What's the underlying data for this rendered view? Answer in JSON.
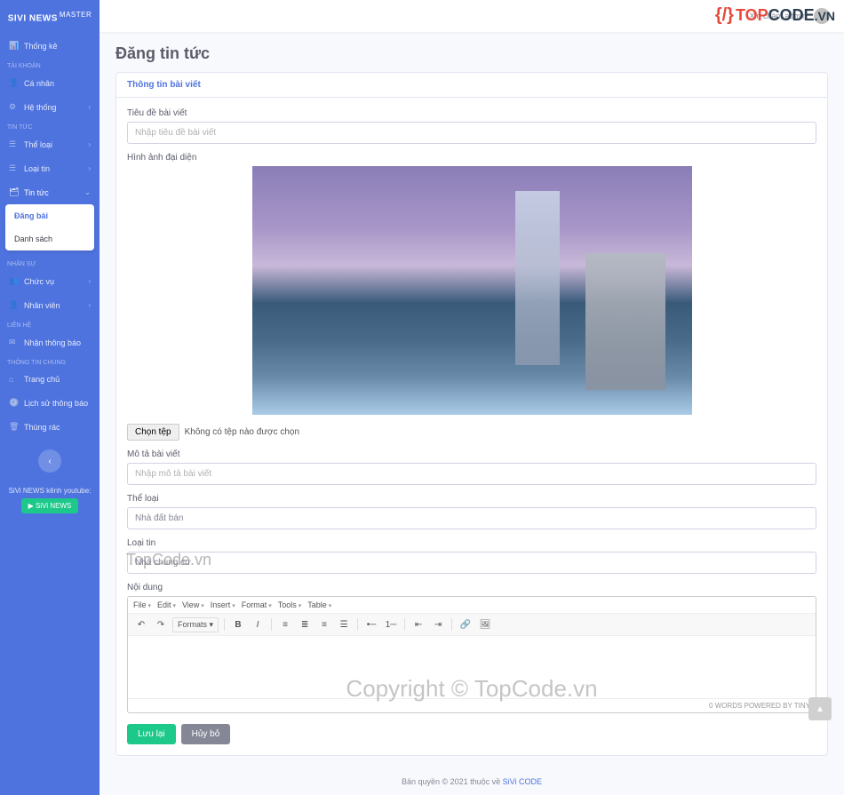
{
  "brand": {
    "name": "SIVI NEWS",
    "sup": "MASTER"
  },
  "sidebar": {
    "sections": [
      {
        "items": [
          {
            "icon": "📊",
            "label": "Thống kê",
            "chev": false
          }
        ]
      },
      {
        "title": "TÀI KHOẢN",
        "items": [
          {
            "icon": "👤",
            "label": "Cá nhân",
            "chev": false
          },
          {
            "icon": "⚙",
            "label": "Hệ thống",
            "chev": true
          }
        ]
      },
      {
        "title": "TIN TỨC",
        "items": [
          {
            "icon": "☰",
            "label": "Thể loại",
            "chev": true
          },
          {
            "icon": "☰",
            "label": "Loại tin",
            "chev": true
          },
          {
            "icon": "🗂",
            "label": "Tin tức",
            "chev": true,
            "active": true,
            "open": true,
            "sub": [
              {
                "label": "Đăng bài",
                "active": true
              },
              {
                "label": "Danh sách",
                "active": false
              }
            ]
          }
        ]
      },
      {
        "title": "NHÂN SỰ",
        "items": [
          {
            "icon": "👥",
            "label": "Chức vụ",
            "chev": true
          },
          {
            "icon": "👤",
            "label": "Nhân viên",
            "chev": true
          }
        ]
      },
      {
        "title": "LIÊN HỆ",
        "items": [
          {
            "icon": "✉",
            "label": "Nhận thông báo",
            "chev": false
          }
        ]
      },
      {
        "title": "THÔNG TIN CHUNG",
        "items": [
          {
            "icon": "⌂",
            "label": "Trang chủ",
            "chev": false
          },
          {
            "icon": "🕘",
            "label": "Lịch sử thông báo",
            "chev": false
          },
          {
            "icon": "🗑",
            "label": "Thùng rác",
            "chev": false
          }
        ]
      }
    ],
    "footer": {
      "text": "SiVi NEWS kênh youtube:",
      "btn": "▶ SiVi NEWS"
    }
  },
  "topbar": {
    "user": "Xin chào, admin"
  },
  "logo": {
    "top": "TOP",
    "code": "CODE",
    "vn": ".VN"
  },
  "page": {
    "title": "Đăng tin tức"
  },
  "card": {
    "head": "Thông tin bài viết"
  },
  "form": {
    "title": {
      "label": "Tiêu đề bài viết",
      "placeholder": "Nhập tiêu đề bài viết"
    },
    "image": {
      "label": "Hình ảnh đại diện",
      "btn": "Chọn tệp",
      "status": "Không có tệp nào được chọn"
    },
    "desc": {
      "label": "Mô tả bài viết",
      "placeholder": "Nhập mô tả bài viết"
    },
    "category": {
      "label": "Thể loại",
      "value": "Nhà đất bán"
    },
    "type": {
      "label": "Loại tin",
      "value": "Nhà chung cư"
    },
    "content": {
      "label": "Nội dung"
    }
  },
  "editor": {
    "menu": [
      "File",
      "Edit",
      "View",
      "Insert",
      "Format",
      "Tools",
      "Table"
    ],
    "formats": "Formats",
    "foot": "0 WORDS POWERED BY TINY"
  },
  "buttons": {
    "save": "Lưu lại",
    "cancel": "Hủy bỏ"
  },
  "footer": {
    "text": "Bản quyền © 2021 thuộc về ",
    "link": "SiVi CODE"
  },
  "watermarks": {
    "w1": "TopCode.vn",
    "w2": "Copyright © TopCode.vn"
  }
}
